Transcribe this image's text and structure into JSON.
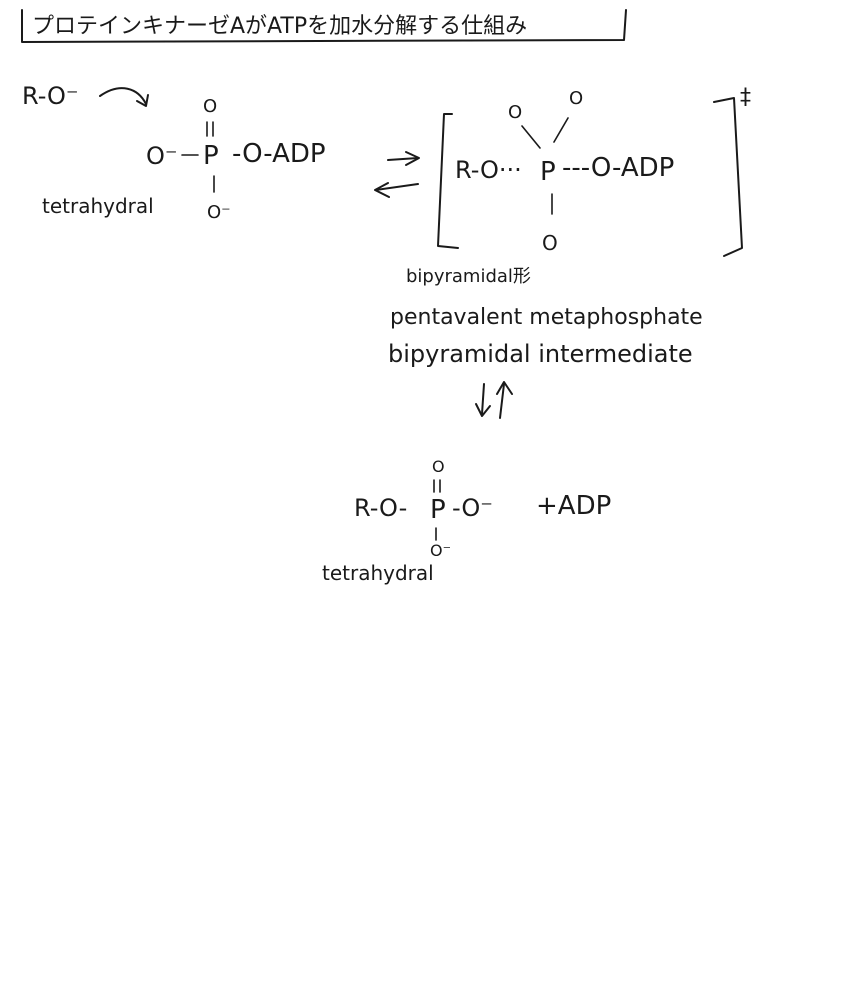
{
  "title": "プロテインキナーゼAがATPを加水分解する仕組み",
  "reactant": {
    "nucleophile": "R-O⁻",
    "top_o": "O",
    "double_bond": "=",
    "left_o": "O⁻",
    "phosphorus": "P",
    "bridge": "-O-ADP",
    "bottom_o": "O⁻",
    "geometry_label": "tetrahydral"
  },
  "transition_state": {
    "left_group": "R-O···",
    "phosphorus": "P",
    "right_group": "---O-ADP",
    "top_o_1": "O",
    "top_o_2": "O",
    "bottom_o": "O",
    "dagger": "‡",
    "labels": [
      "bipyramidal形",
      "pentavalent metaphosphate",
      "bipyramidal intermediate"
    ]
  },
  "equilibrium_arrow_down_up": "⇅",
  "product": {
    "left_group": "R-O-",
    "phosphorus": "P",
    "right_group": "-O⁻",
    "top_o": "O",
    "bottom_o": "O⁻",
    "plus_adp": "+ADP",
    "geometry_label": "tetrahydral"
  }
}
